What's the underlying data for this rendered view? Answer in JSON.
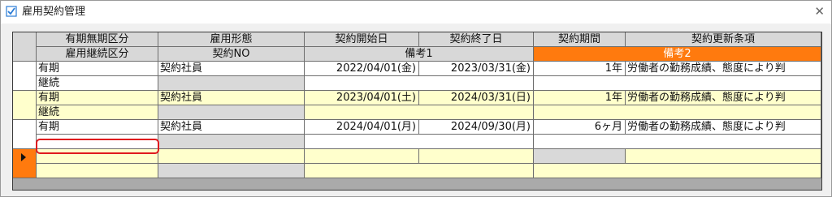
{
  "window": {
    "title": "雇用契約管理",
    "close_glyph": "✕"
  },
  "header": {
    "row1": [
      "有期無期区分",
      "雇用形態",
      "契約開始日",
      "契約終了日",
      "契約期間",
      "契約更新条項"
    ],
    "row2": [
      "雇用継続区分",
      "契約NO",
      "備考1",
      "備考2"
    ]
  },
  "records": [
    {
      "term_type": "有期",
      "employment_type": "契約社員",
      "start_date": "2022/04/01(金)",
      "end_date": "2023/03/31(金)",
      "period": "1年",
      "renewal_clause": "労働者の勤務成績、態度により判",
      "continuation": "継続",
      "contract_no": "",
      "note1": "",
      "note2": ""
    },
    {
      "term_type": "有期",
      "employment_type": "契約社員",
      "start_date": "2023/04/01(土)",
      "end_date": "2024/03/31(日)",
      "period": "1年",
      "renewal_clause": "労働者の勤務成績、態度により判",
      "continuation": "継続",
      "contract_no": "",
      "note1": "",
      "note2": ""
    },
    {
      "term_type": "有期",
      "employment_type": "契約社員",
      "start_date": "2024/04/01(月)",
      "end_date": "2024/09/30(月)",
      "period": "6ヶ月",
      "renewal_clause": "労働者の勤務成績、態度により判",
      "continuation": "",
      "contract_no": "",
      "note1": "",
      "note2": ""
    }
  ],
  "new_row": {
    "term_type": "",
    "employment_type": "",
    "start_date": "",
    "end_date": "",
    "period": "",
    "renewal_clause": "",
    "continuation": "",
    "contract_no": "",
    "note1": "",
    "note2": ""
  },
  "colors": {
    "header_gray": "#d8d8d8",
    "accent_orange": "#ff7a0e",
    "row_alt_yellow": "#ffffcc",
    "highlight_red": "#e0191e"
  }
}
